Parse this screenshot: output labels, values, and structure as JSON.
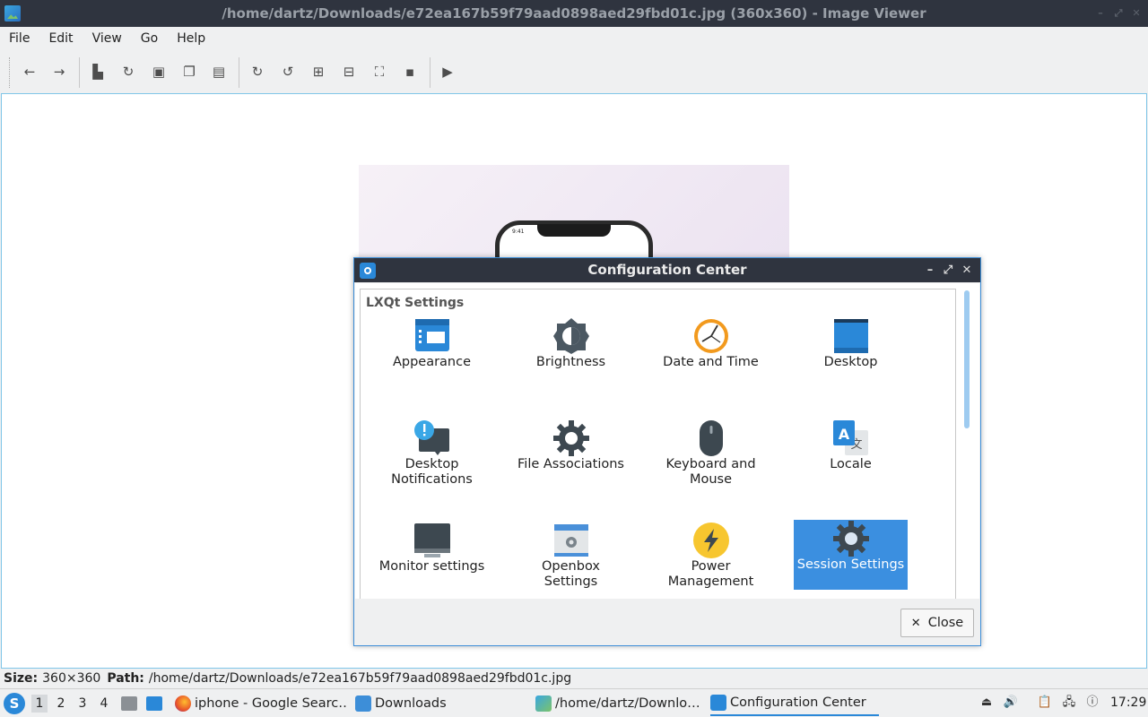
{
  "window": {
    "title": "/home/dartz/Downloads/e72ea167b59f79aad0898aed29fbd01c.jpg (360x360) - Image Viewer"
  },
  "menu": [
    "File",
    "Edit",
    "View",
    "Go",
    "Help"
  ],
  "toolbar": {
    "buttons": [
      "back-icon",
      "forward-icon",
      "open-icon",
      "reload-icon",
      "save-icon",
      "copy-icon",
      "paste-icon",
      "rotate-clockwise-icon",
      "rotate-counterclockwise-icon",
      "zoom-in-icon",
      "zoom-out-icon",
      "fit-icon",
      "original-size-icon",
      "slideshow-icon"
    ]
  },
  "photo": {
    "phone_time": "9:41"
  },
  "statusbar": {
    "size_label": "Size:",
    "size_value": "360×360",
    "path_label": "Path:",
    "path_value": "/home/dartz/Downloads/e72ea167b59f79aad0898aed29fbd01c.jpg"
  },
  "dialog": {
    "title": "Configuration Center",
    "section_title": "LXQt Settings",
    "items": [
      {
        "label": "Appearance",
        "icon": "appearance-icon"
      },
      {
        "label": "Brightness",
        "icon": "brightness-icon"
      },
      {
        "label": "Date and Time",
        "icon": "clock-icon"
      },
      {
        "label": "Desktop",
        "icon": "desktop-icon"
      },
      {
        "label": "Desktop\nNotifications",
        "icon": "notifications-icon"
      },
      {
        "label": "File Associations",
        "icon": "gear-icon"
      },
      {
        "label": "Keyboard and\nMouse",
        "icon": "mouse-icon"
      },
      {
        "label": "Locale",
        "icon": "locale-icon"
      },
      {
        "label": "Monitor settings",
        "icon": "monitor-icon"
      },
      {
        "label": "Openbox Settings",
        "icon": "openbox-icon"
      },
      {
        "label": "Power Management",
        "icon": "power-icon"
      },
      {
        "label": "Session Settings",
        "icon": "session-icon",
        "selected": true
      }
    ],
    "close_label": "Close"
  },
  "taskbar": {
    "desktops": [
      "1",
      "2",
      "3",
      "4"
    ],
    "active_desktop": "1",
    "tasks": [
      {
        "label": "iphone - Google Searc…",
        "icon": "firefox-icon"
      },
      {
        "label": "Downloads",
        "icon": "folder-icon"
      },
      {
        "label": "/home/dartz/Downlo…",
        "icon": "image-viewer-icon"
      },
      {
        "label": "Configuration Center",
        "icon": "configuration-icon",
        "active": true
      }
    ],
    "clock": "17:29"
  },
  "colors": {
    "titlebar": "#2f343f",
    "accent": "#3b8fe0",
    "window_bg": "#eff0f1"
  }
}
